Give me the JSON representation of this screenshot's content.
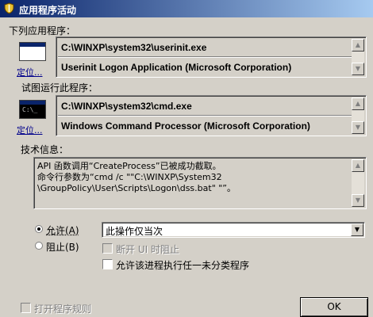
{
  "window": {
    "title": "应用程序活动"
  },
  "sections": {
    "following_program_label": "下列应用程序：",
    "attempting_program_label": "试图运行此程序：",
    "tech_info_label": "技术信息："
  },
  "program1": {
    "path": "C:\\WINXP\\system32\\userinit.exe",
    "description": "Userinit Logon Application (Microsoft Corporation)",
    "locate_link": "定位..."
  },
  "program2": {
    "path": "C:\\WINXP\\system32\\cmd.exe",
    "description": "Windows Command Processor (Microsoft Corporation)",
    "locate_link": "定位...",
    "icon_text": "C:\\_"
  },
  "tech_info": {
    "line1": "API 函数调用“CreateProcess”已被成功截取。",
    "line2": "命令行参数为“cmd /c \"\"C:\\WINXP\\System32",
    "line3": "\\GroupPolicy\\User\\Scripts\\Logon\\dss.bat\" \"”。"
  },
  "options": {
    "allow_label": "允许(A)",
    "allow_checked": true,
    "block_label": "阻止(B)",
    "block_checked": false,
    "action_select_value": "此操作仅当次",
    "disconnect_label": "断开 UI 时阻止",
    "disconnect_enabled": false,
    "allow_uncategorized_label": "允许该进程执行任一未分类程序",
    "allow_uncategorized_checked": false
  },
  "footer": {
    "open_rules_label": "打开程序规则",
    "open_rules_enabled": false,
    "ok_label": "OK"
  }
}
